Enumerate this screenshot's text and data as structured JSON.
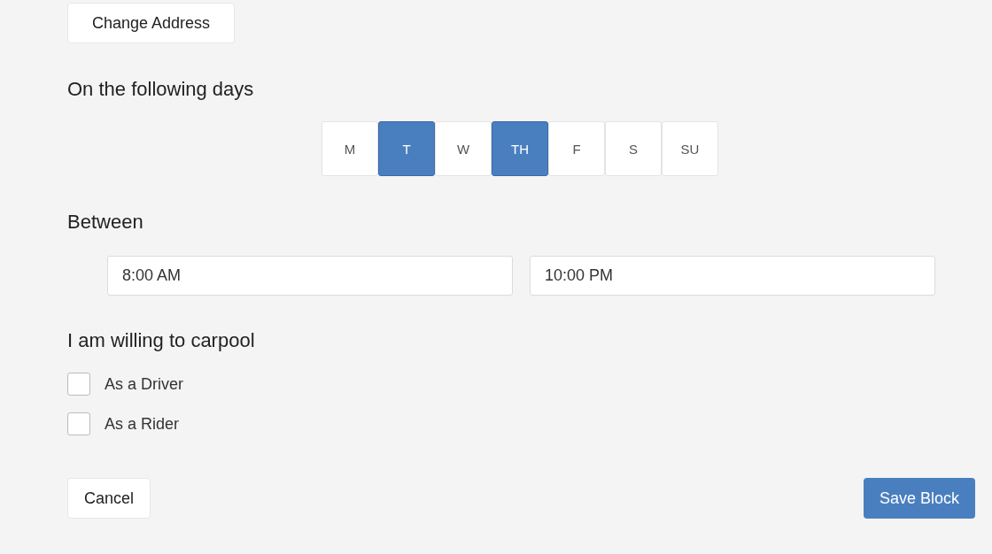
{
  "change_address_button": "Change Address",
  "days_heading": "On the following days",
  "days": [
    {
      "label": "M",
      "selected": false
    },
    {
      "label": "T",
      "selected": true
    },
    {
      "label": "W",
      "selected": false
    },
    {
      "label": "TH",
      "selected": true
    },
    {
      "label": "F",
      "selected": false
    },
    {
      "label": "S",
      "selected": false
    },
    {
      "label": "SU",
      "selected": false
    }
  ],
  "between_heading": "Between",
  "times": [
    {
      "value": "8:00 AM"
    },
    {
      "value": "10:00 PM"
    }
  ],
  "carpool_heading": "I am willing to carpool",
  "carpool_options": [
    {
      "label": "As a Driver",
      "checked": false
    },
    {
      "label": "As a Rider",
      "checked": false
    }
  ],
  "buttons": {
    "cancel": "Cancel",
    "save": "Save Block"
  }
}
